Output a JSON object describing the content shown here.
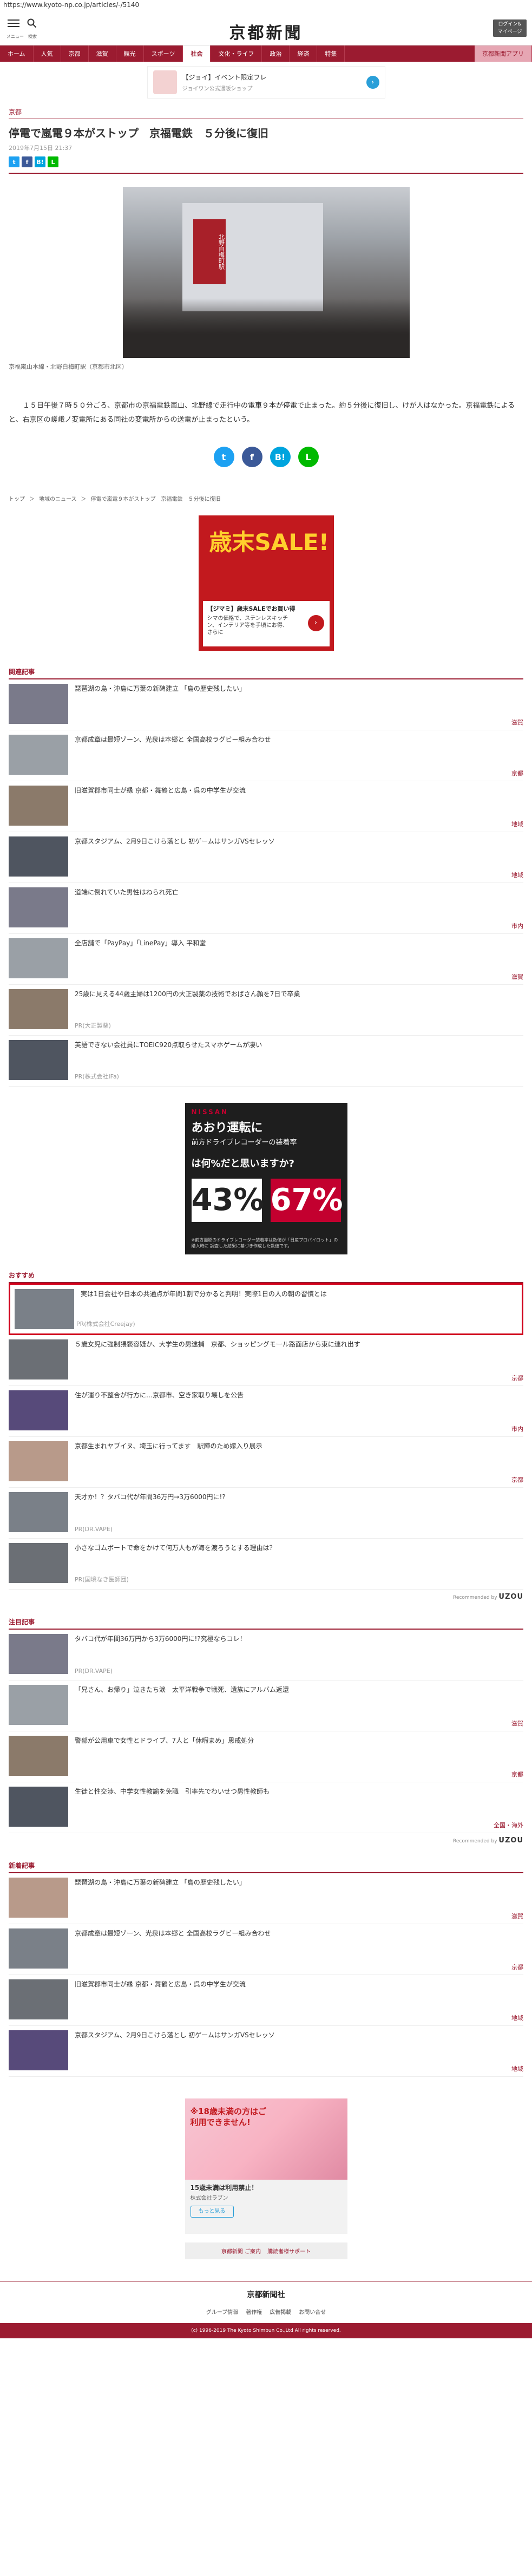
{
  "browser": {
    "url": "https://www.kyoto-np.co.jp/articles/-/5140"
  },
  "header": {
    "menu_caption": "メニュー",
    "search_caption": "検索",
    "logo": "京都新聞",
    "login_line1": "ログイン&",
    "login_line2": "マイページ"
  },
  "nav": {
    "items": [
      "ホーム",
      "人気",
      "京都",
      "滋賀",
      "観光",
      "スポーツ",
      "社会",
      "文化・ライフ",
      "政治",
      "経済",
      "特集"
    ],
    "active_index": 6,
    "special_item": "京都新聞アプリ"
  },
  "ad_top": {
    "title": "【ジョイ】イベント限定フレ",
    "sub": "ジョイワン公式通販ショップ",
    "arrow": "›"
  },
  "article": {
    "category": "京都",
    "title": "停電で嵐電９本がストップ　京福電鉄　５分後に復旧",
    "date": "2019年7月15日 21:37",
    "photo_sign_text": "北野白梅町駅",
    "caption": "京福嵐山本線・北野白梅町駅（京都市北区）",
    "body": "　１５日午後７時５０分ごろ、京都市の京福電鉄嵐山、北野線で走行中の電車９本が停電で止まった。約５分後に復旧し、けが人はなかった。京福電鉄によると、右京区の嵯峨ノ変電所にある同社の変電所からの送電が止まったという。"
  },
  "share": {
    "twitter": "t",
    "facebook": "f",
    "hatena": "B!",
    "line": "L"
  },
  "breadcrumbs": [
    "トップ",
    "＞",
    "地域のニュース",
    "＞",
    "停電で嵐電９本がストップ　京福電鉄　５分後に復旧"
  ],
  "ad_sale": {
    "headline": "歳末SALE!",
    "title": "【ジマミ】歳末SALEでお買い得",
    "text": "シマの価格で、ステンレスキッチン、インテリア等を手頃にお得、さらに"
  },
  "related": {
    "heading": "関連記事",
    "items": [
      {
        "text": "琵琶湖の島・沖島に万葉の新碑建立 「島の歴史残したい」",
        "tag": "滋賀"
      },
      {
        "text": "京都成章は最短ゾーン、光泉は本郷と 全国高校ラグビー組み合わせ",
        "tag": "京都"
      },
      {
        "text": "旧滋賀郡市同士が縁 京都・舞鶴と広島・呉の中学生が交流",
        "tag": "地域"
      },
      {
        "text": "京都スタジアム、2月9日こけら落とし 初ゲームはサンガVSセレッソ",
        "tag": "地域"
      },
      {
        "text": "道端に倒れていた男性はねられ死亡",
        "tag": "市内"
      },
      {
        "text": "全店舗で「PayPay」「LinePay」導入 平和堂",
        "tag": "滋賀"
      },
      {
        "text": "25歳に見える44歳主婦は1200円の大正製薬の技術でおばさん顔を7日で卒業",
        "pr": "PR(大正製薬)"
      },
      {
        "text": "英語できない会社員にTOEIC920点取らせたスマホゲームが凄い",
        "pr": "PR(株式会社iFa)"
      }
    ]
  },
  "ad_nissan": {
    "brand": "NISSAN",
    "headline": "あおり運転に",
    "sub": "前方ドライブレコーダーの装着率",
    "ask": "は何%だと思いますか?",
    "left": "43%",
    "right": "67%",
    "note": "※前方撮影のドライブレコーダー装着率は数値が「日産プロパイロット」の購入時に 調査した結果に基づき作成した数値です。"
  },
  "recommend": {
    "heading": "おすすめ",
    "items": [
      {
        "text": "実は1日会社や日本の共通点が年間1割で分かると判明！実際1日の人の朝の習慣とは",
        "pr": "PR(株式会社Creejay)"
      },
      {
        "text": "５歳女児に強制猥褻容疑か、大学生の男逮捕　京都、ショッピングモール路面店から東に連れ出す",
        "tag": "京都"
      },
      {
        "text": "住が運り不整合が行方に…京都市、空き家取り壊しを公告",
        "tag": "市内"
      },
      {
        "text": "京都生まれヤブイヌ、埼玉に行ってます　駅陣のため嫁入り展示",
        "tag": "京都"
      },
      {
        "text": "天才か！？タバコ代が年間36万円→3万6000円に!?",
        "pr": "PR(DR.VAPE)"
      },
      {
        "text": "小さなゴムボートで命をかけて何万人もが海を渡ろうとする理由は？",
        "pr": "PR(国境なき医師団)"
      }
    ],
    "by": "Recommended by",
    "by_brand": "UZOU"
  },
  "notable": {
    "heading": "注目記事",
    "items": [
      {
        "text": "タバコ代が年間36万円から3万6000円に!?究極ならコレ！",
        "pr": "PR(DR.VAPE)"
      },
      {
        "text": "「兄さん、お帰り」泣きたち涙　太平洋戦争で戦死、遺族にアルバム返還",
        "tag": "滋賀"
      },
      {
        "text": "警部が公用車で女性とドライブ、7人と「休暇まめ」思戒処分",
        "tag": "京都"
      },
      {
        "text": "生徒と性交渉、中学女性教諭を免職　引率先でわいせつ男性教師も",
        "tag": "全国・海外"
      }
    ],
    "by": "Recommended by",
    "by_brand": "UZOU"
  },
  "newest": {
    "heading": "新着記事",
    "items": [
      {
        "text": "琵琶湖の島・沖島に万葉の新碑建立 「島の歴史残したい」",
        "tag": "滋賀"
      },
      {
        "text": "京都成章は最短ゾーン、光泉は本郷と 全国高校ラグビー組み合わせ",
        "tag": "京都"
      },
      {
        "text": "旧滋賀郡市同士が縁 京都・舞鶴と広島・呉の中学生が交流",
        "tag": "地域"
      },
      {
        "text": "京都スタジアム、2月9日こけら落とし 初ゲームはサンガVSセレッソ",
        "tag": "地域"
      }
    ]
  },
  "ad_bottom": {
    "hero": "※18歳未満の方はご利用できません!",
    "title": "15歳未満は利用禁止！",
    "sub": "株式会社ラブン",
    "button": "もっと見る"
  },
  "sub_links": {
    "a": "京都新聞 ご案内",
    "b": "購読者様サポート"
  },
  "footer": {
    "logo": "京都新聞社",
    "links": [
      "グループ情報",
      "著作権",
      "広告掲載",
      "お問い合せ"
    ],
    "copyright": "(c) 1996-2019 The Kyoto Shimbun Co.,Ltd All rights reserved."
  }
}
